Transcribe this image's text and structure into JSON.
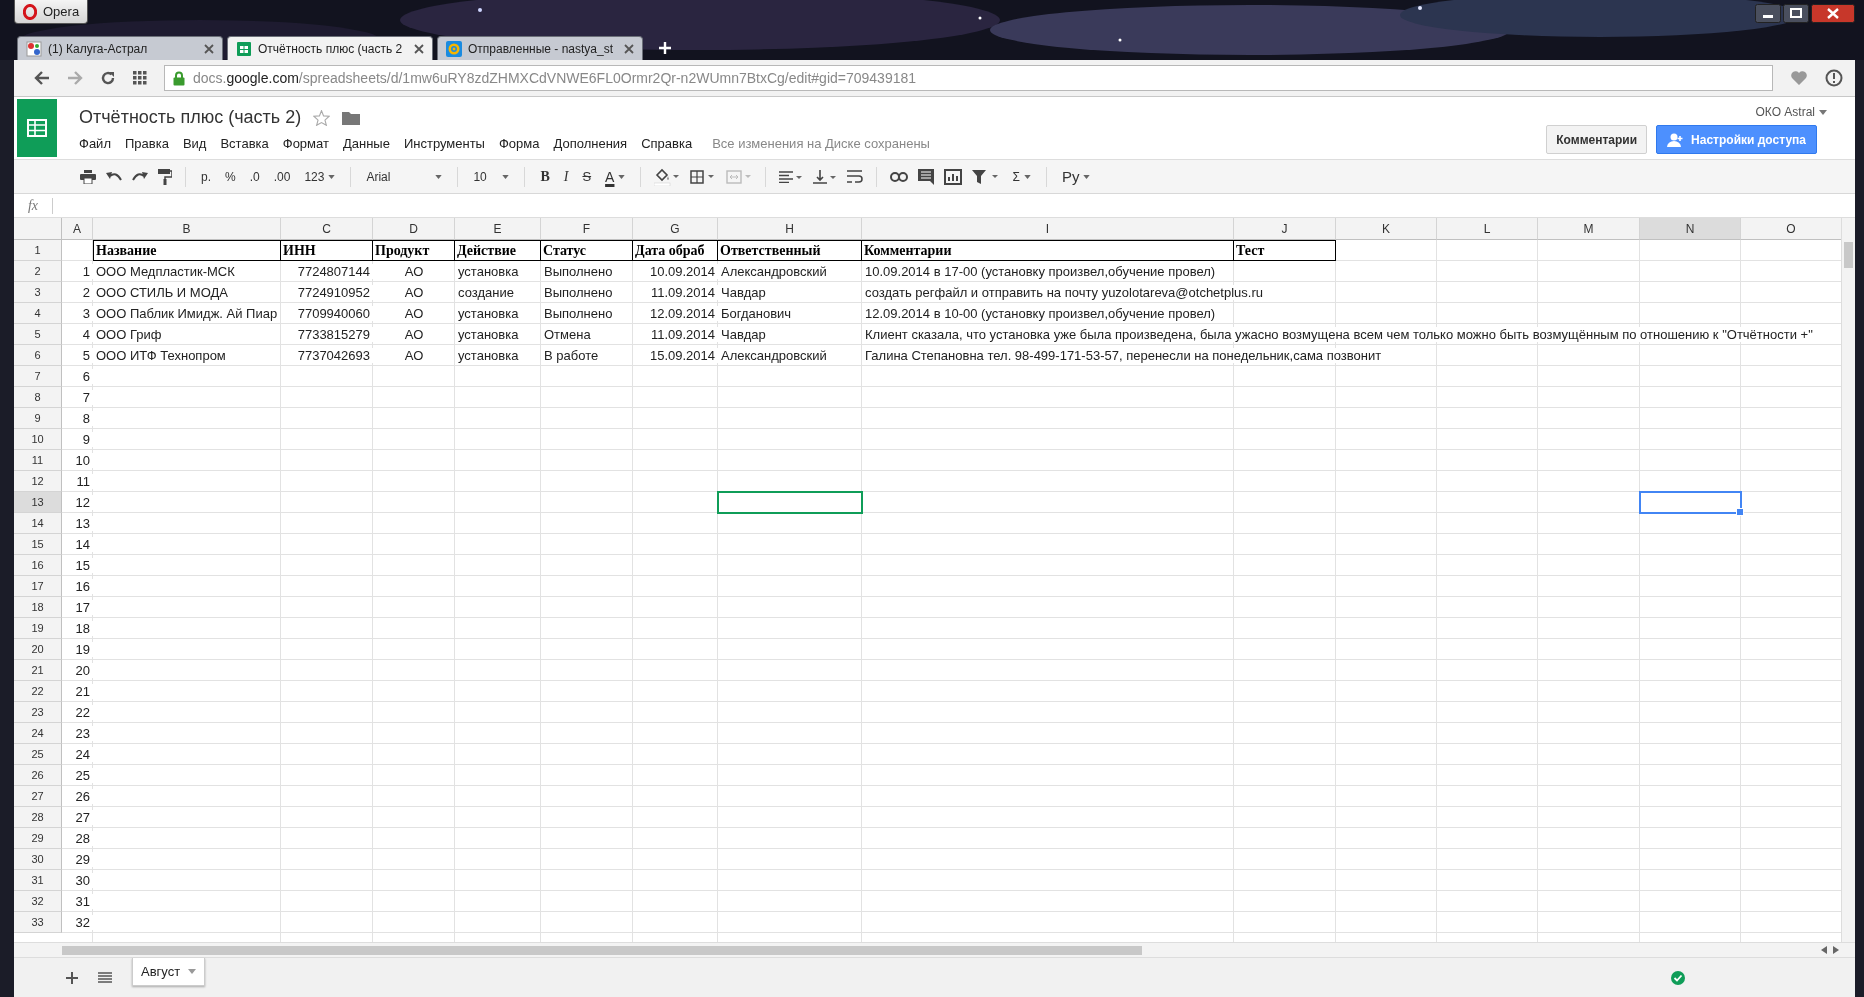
{
  "browser": {
    "menu_label": "Opera",
    "tabs": [
      {
        "label": "(1) Калуга-Астрал",
        "selected": false
      },
      {
        "label": "Отчётность плюс (часть 2",
        "selected": true
      },
      {
        "label": "Отправленные - nastya_st",
        "selected": false
      }
    ],
    "address": {
      "prefix": "docs.",
      "domain": "google.com",
      "path": "/spreadsheets/d/1mw6uRY8zdZHMXCdVNWE6FL0Ormr2Qr-n2WUmn7BtxCg/edit#gid=709439181"
    }
  },
  "doc": {
    "title": "Отчётность плюс (часть 2)",
    "starred": false,
    "menu": [
      "Файл",
      "Правка",
      "Вид",
      "Вставка",
      "Формат",
      "Данные",
      "Инструменты",
      "Форма",
      "Дополнения",
      "Справка"
    ],
    "save_status": "Все изменения на Диске сохранены",
    "account": "ОКО Astral",
    "comments_button": "Комментарии",
    "share_button": "Настройки доступа"
  },
  "toolbar": {
    "currency": "р.",
    "percent": "%",
    "decrease_decimals": ".0",
    "increase_decimals": ".00",
    "number_format": "123",
    "font": "Arial",
    "font_size": "10",
    "bold": "B",
    "italic": "I",
    "strikethrough": "S",
    "text_color": "A",
    "functions": "Σ",
    "input_tools": "Ру"
  },
  "formula_bar": {
    "label": "fx"
  },
  "sheet": {
    "columns": [
      {
        "label": "A",
        "selected": false
      },
      {
        "label": "B",
        "selected": false
      },
      {
        "label": "C",
        "selected": false
      },
      {
        "label": "D",
        "selected": false
      },
      {
        "label": "E",
        "selected": false
      },
      {
        "label": "F",
        "selected": false
      },
      {
        "label": "G",
        "selected": false
      },
      {
        "label": "H",
        "selected": false
      },
      {
        "label": "I",
        "selected": false
      },
      {
        "label": "J",
        "selected": false
      },
      {
        "label": "K",
        "selected": false
      },
      {
        "label": "L",
        "selected": false
      },
      {
        "label": "M",
        "selected": false
      },
      {
        "label": "N",
        "selected": true
      },
      {
        "label": "O",
        "selected": false
      }
    ],
    "rows": [
      {
        "number": "1",
        "selected": false,
        "kind": "header",
        "cells": [
          null,
          "Название",
          "ИНН",
          "Продукт",
          "Действие",
          "Статус",
          "Дата обраб",
          "Ответственный",
          "Комментарии",
          "Тест"
        ]
      },
      {
        "number": "2",
        "selected": false,
        "kind": "data",
        "cells": [
          "1",
          "ООО Медпластик-МСК",
          "7724807144",
          "АО",
          "установка",
          "Выполнено",
          "10.09.2014",
          "Александровский",
          "10.09.2014 в 17-00 (установку произвел,обучение провел)"
        ]
      },
      {
        "number": "3",
        "selected": false,
        "kind": "data",
        "cells": [
          "2",
          "ООО СТИЛЬ И МОДА",
          "7724910952",
          "АО",
          "создание",
          "Выполнено",
          "11.09.2014",
          "Чавдар",
          "создать регфайл и отправить на почту yuzolotareva@otchetplus.ru"
        ]
      },
      {
        "number": "4",
        "selected": false,
        "kind": "data",
        "cells": [
          "3",
          "ООО Паблик Имидж. Ай Пиар",
          "7709940060",
          "АО",
          "установка",
          "Выполнено",
          "12.09.2014",
          "Богданович",
          "12.09.2014 в 10-00 (установку произвел,обучение провел)"
        ]
      },
      {
        "number": "5",
        "selected": false,
        "kind": "data",
        "cells": [
          "4",
          "ООО Гриф",
          "7733815279",
          "АО",
          "установка",
          "Отмена",
          "11.09.2014",
          "Чавдар",
          "Клиент сказала, что установка уже была произведена, была ужасно возмущена всем чем только можно быть возмущённым по отношению к \"Отчётности +\""
        ]
      },
      {
        "number": "6",
        "selected": false,
        "kind": "data",
        "cells": [
          "5",
          "ООО ИТФ Технопром",
          "7737042693",
          "АО",
          "установка",
          "В работе",
          "15.09.2014",
          "Александровский",
          "Галина Степановна тел. 98-499-171-53-57, перенесли на понедельник,сама позвонит"
        ]
      },
      {
        "number": "7",
        "selected": false,
        "kind": "data",
        "cells": [
          "6"
        ]
      },
      {
        "number": "8",
        "selected": false,
        "kind": "data",
        "cells": [
          "7"
        ]
      },
      {
        "number": "9",
        "selected": false,
        "kind": "data",
        "cells": [
          "8"
        ]
      },
      {
        "number": "10",
        "selected": false,
        "kind": "data",
        "cells": [
          "9"
        ]
      },
      {
        "number": "11",
        "selected": false,
        "kind": "data",
        "cells": [
          "10"
        ]
      },
      {
        "number": "12",
        "selected": false,
        "kind": "data",
        "cells": [
          "11"
        ]
      },
      {
        "number": "13",
        "selected": true,
        "kind": "data",
        "cells": [
          "12",
          null,
          null,
          null,
          null,
          null,
          null,
          {
            "kind": "collaborator_cursor",
            "color": "#0f9d58"
          }
        ]
      },
      {
        "number": "14",
        "selected": false,
        "kind": "data",
        "cells": [
          "13"
        ]
      },
      {
        "number": "15",
        "selected": false,
        "kind": "data",
        "cells": [
          "14"
        ]
      },
      {
        "number": "16",
        "selected": false,
        "kind": "data",
        "cells": [
          "15"
        ]
      },
      {
        "number": "17",
        "selected": false,
        "kind": "data",
        "cells": [
          "16"
        ]
      },
      {
        "number": "18",
        "selected": false,
        "kind": "data",
        "cells": [
          "17"
        ]
      },
      {
        "number": "19",
        "selected": false,
        "kind": "data",
        "cells": [
          "18"
        ]
      },
      {
        "number": "20",
        "selected": false,
        "kind": "data",
        "cells": [
          "19"
        ]
      },
      {
        "number": "21",
        "selected": false,
        "kind": "data",
        "cells": [
          "20"
        ]
      },
      {
        "number": "22",
        "selected": false,
        "kind": "data",
        "cells": [
          "21"
        ]
      },
      {
        "number": "23",
        "selected": false,
        "kind": "data",
        "cells": [
          "22"
        ]
      },
      {
        "number": "24",
        "selected": false,
        "kind": "data",
        "cells": [
          "23"
        ]
      },
      {
        "number": "25",
        "selected": false,
        "kind": "data",
        "cells": [
          "24"
        ]
      },
      {
        "number": "26",
        "selected": false,
        "kind": "data",
        "cells": [
          "25"
        ]
      },
      {
        "number": "27",
        "selected": false,
        "kind": "data",
        "cells": [
          "26"
        ]
      },
      {
        "number": "28",
        "selected": false,
        "kind": "data",
        "cells": [
          "27"
        ]
      },
      {
        "number": "29",
        "selected": false,
        "kind": "data",
        "cells": [
          "28"
        ]
      },
      {
        "number": "30",
        "selected": false,
        "kind": "data",
        "cells": [
          "29"
        ]
      },
      {
        "number": "31",
        "selected": false,
        "kind": "data",
        "cells": [
          "30"
        ]
      },
      {
        "number": "32",
        "selected": false,
        "kind": "data",
        "cells": [
          "31"
        ]
      },
      {
        "number": "33",
        "selected": false,
        "kind": "data",
        "cells": [
          "32"
        ]
      }
    ]
  },
  "sheet_tabs": [
    {
      "label": "Август",
      "selected": true
    }
  ]
}
